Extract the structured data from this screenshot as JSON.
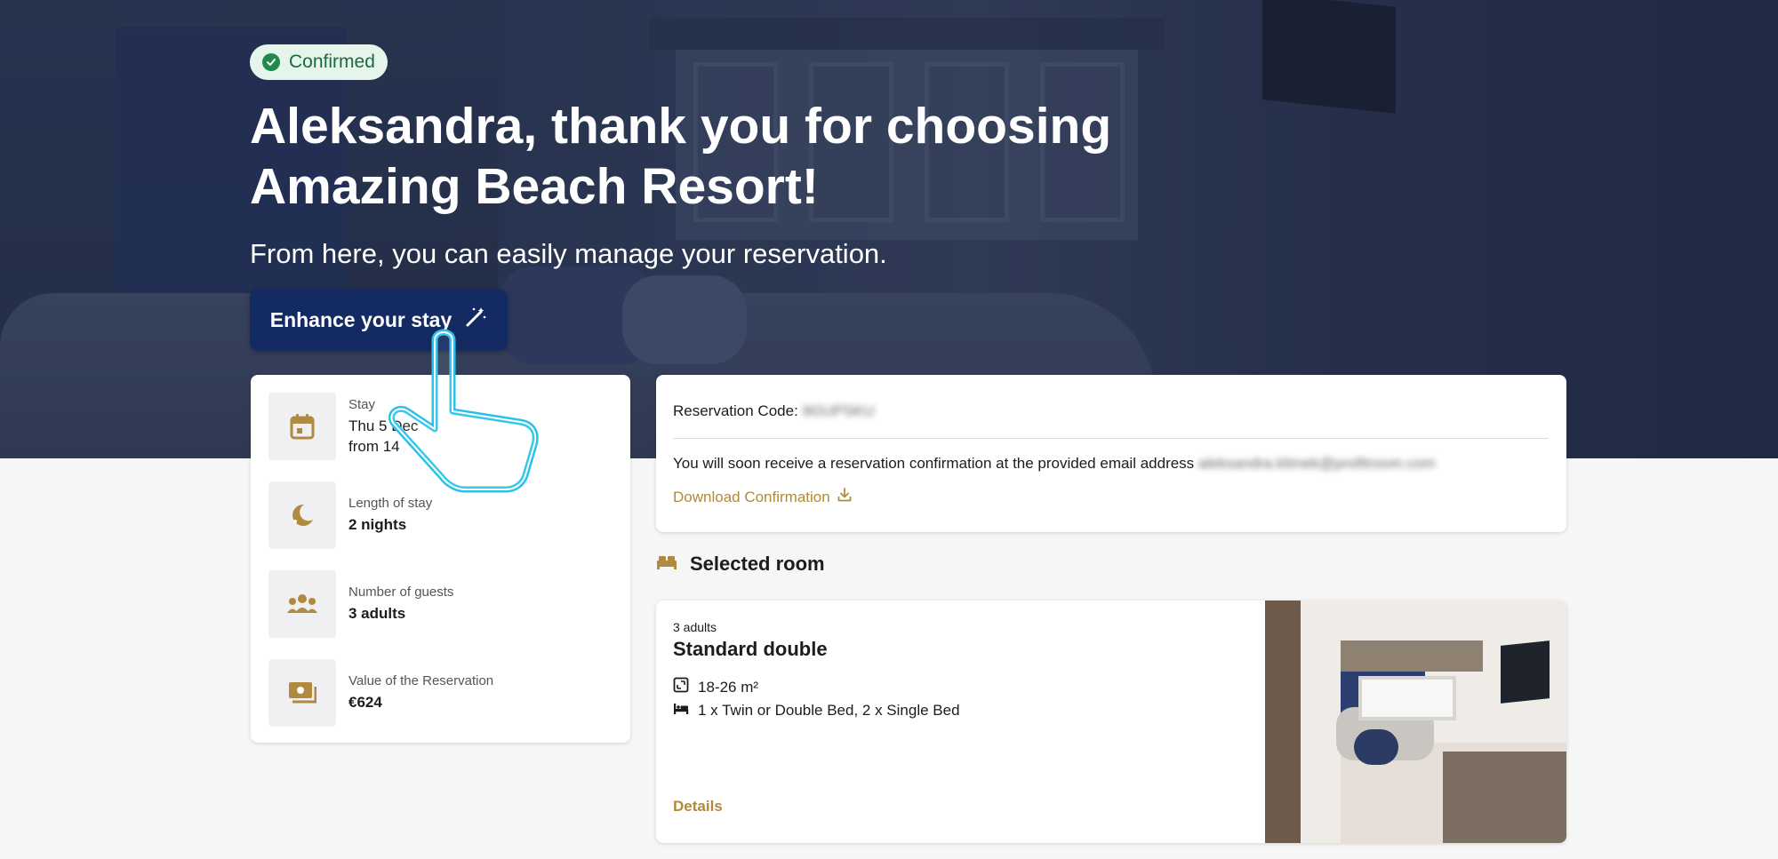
{
  "hero": {
    "status_badge": "Confirmed",
    "title": "Aleksandra, thank you for choosing Amazing Beach Resort!",
    "subtitle": "From here, you can easily manage your reservation.",
    "enhance_button": "Enhance your stay",
    "enhance_icon": "magic-wand-icon"
  },
  "details": [
    {
      "label": "Stay",
      "value_line1": "Thu 5 Dec",
      "value_line2": "from 14",
      "icon": "calendar-icon"
    },
    {
      "label": "Length of stay",
      "value": "2 nights",
      "icon": "moon-icon"
    },
    {
      "label": "Number of guests",
      "value": "3 adults",
      "icon": "guests-icon"
    },
    {
      "label": "Value of the Reservation",
      "value": "€624",
      "icon": "money-icon"
    }
  ],
  "reservation": {
    "code_label": "Reservation Code:",
    "code_value": "9GUPSKU",
    "email_text": "You will soon receive a reservation confirmation at the provided email address",
    "email_value": "aleksandra.klimek@profitroom.com",
    "download_label": "Download Confirmation",
    "download_icon": "download-icon"
  },
  "selected_room": {
    "heading": "Selected room",
    "heading_icon": "bed-icon",
    "occupancy": "3 adults",
    "name": "Standard double",
    "size": "18-26 m²",
    "size_icon": "area-icon",
    "beds": "1 x Twin or Double Bed, 2 x Single Bed",
    "beds_icon": "bed-icon",
    "details_link": "Details"
  },
  "colors": {
    "accent_gold": "#b08a3e",
    "primary_navy": "#142a63",
    "badge_green": "#1f8a4c",
    "cursor_cyan": "#29c3ea"
  }
}
